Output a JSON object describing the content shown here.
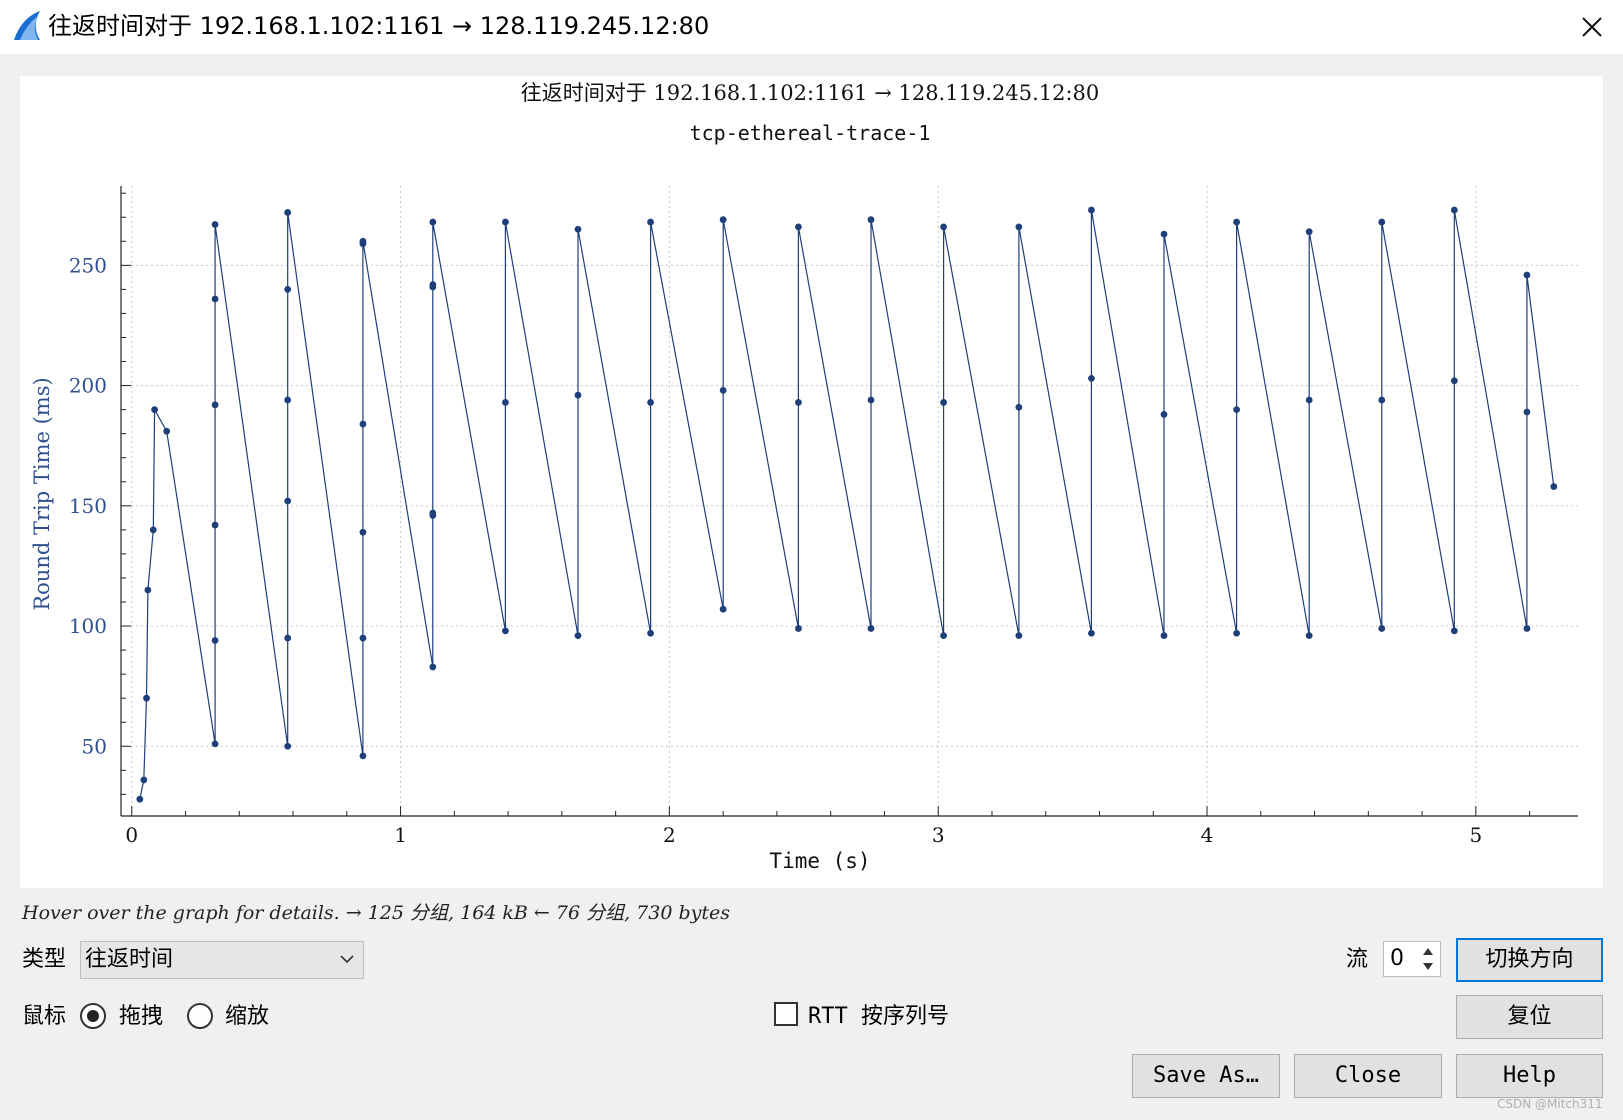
{
  "window": {
    "title": "往返时间对于 192.168.1.102:1161 → 128.119.245.12:80",
    "close_label": "✕"
  },
  "colors": {
    "series": "#1f3f7a",
    "axis_label": "#30508f",
    "grid": "#c8c8c8"
  },
  "chart_data": {
    "type": "scatter",
    "title": "往返时间对于 192.168.1.102:1161 → 128.119.245.12:80",
    "subtitle": "tcp-ethereal-trace-1",
    "xlabel": "Time (s)",
    "ylabel": "Round Trip Time (ms)",
    "xlim": [
      -0.04,
      5.38
    ],
    "ylim": [
      21,
      283
    ],
    "xticks": [
      0,
      1,
      2,
      3,
      4,
      5
    ],
    "yticks": [
      50,
      100,
      150,
      200,
      250
    ],
    "grid": true,
    "connected": true,
    "series": [
      {
        "values": [
          [
            0.03,
            28
          ],
          [
            0.045,
            36
          ],
          [
            0.055,
            70
          ],
          [
            0.06,
            115
          ],
          [
            0.08,
            140
          ],
          [
            0.085,
            190
          ],
          [
            0.13,
            181
          ],
          [
            0.31,
            51
          ],
          [
            0.31,
            94
          ],
          [
            0.31,
            142
          ],
          [
            0.31,
            192
          ],
          [
            0.31,
            236
          ],
          [
            0.31,
            267
          ],
          [
            0.58,
            50
          ],
          [
            0.58,
            95
          ],
          [
            0.58,
            152
          ],
          [
            0.58,
            194
          ],
          [
            0.58,
            240
          ],
          [
            0.58,
            272
          ],
          [
            0.86,
            46
          ],
          [
            0.86,
            95
          ],
          [
            0.86,
            139
          ],
          [
            0.86,
            184
          ],
          [
            0.86,
            259
          ],
          [
            0.86,
            260
          ],
          [
            1.12,
            83
          ],
          [
            1.12,
            146
          ],
          [
            1.12,
            147
          ],
          [
            1.12,
            241
          ],
          [
            1.12,
            242
          ],
          [
            1.12,
            268
          ],
          [
            1.39,
            98
          ],
          [
            1.39,
            193
          ],
          [
            1.39,
            268
          ],
          [
            1.66,
            96
          ],
          [
            1.66,
            196
          ],
          [
            1.66,
            265
          ],
          [
            1.93,
            97
          ],
          [
            1.93,
            193
          ],
          [
            1.93,
            268
          ],
          [
            2.2,
            107
          ],
          [
            2.2,
            198
          ],
          [
            2.2,
            269
          ],
          [
            2.48,
            99
          ],
          [
            2.48,
            193
          ],
          [
            2.48,
            266
          ],
          [
            2.75,
            99
          ],
          [
            2.75,
            194
          ],
          [
            2.75,
            269
          ],
          [
            3.02,
            96
          ],
          [
            3.02,
            193
          ],
          [
            3.02,
            266
          ],
          [
            3.3,
            96
          ],
          [
            3.3,
            191
          ],
          [
            3.3,
            266
          ],
          [
            3.57,
            97
          ],
          [
            3.57,
            203
          ],
          [
            3.57,
            273
          ],
          [
            3.84,
            96
          ],
          [
            3.84,
            188
          ],
          [
            3.84,
            263
          ],
          [
            4.11,
            97
          ],
          [
            4.11,
            190
          ],
          [
            4.11,
            268
          ],
          [
            4.38,
            96
          ],
          [
            4.38,
            194
          ],
          [
            4.38,
            264
          ],
          [
            4.65,
            99
          ],
          [
            4.65,
            194
          ],
          [
            4.65,
            268
          ],
          [
            4.92,
            98
          ],
          [
            4.92,
            202
          ],
          [
            4.92,
            273
          ],
          [
            5.19,
            99
          ],
          [
            5.19,
            189
          ],
          [
            5.19,
            246
          ],
          [
            5.29,
            158
          ]
        ]
      }
    ]
  },
  "status_text": "Hover over the graph for details. → 125 分组, 164 kB ← 76 分组, 730 bytes",
  "controls": {
    "type_label": "类型",
    "type_value": "往返时间",
    "mouse_label": "鼠标",
    "drag_label": "拖拽",
    "zoom_label": "缩放",
    "mouse_mode": "drag",
    "rtt_label": "RTT 按序列号",
    "rtt_checked": false,
    "stream_label": "流",
    "stream_value": "0",
    "switch_direction": "切换方向",
    "reset": "复位",
    "save_as": "Save As…",
    "close": "Close",
    "help": "Help"
  },
  "watermark": "CSDN @Mitch311"
}
